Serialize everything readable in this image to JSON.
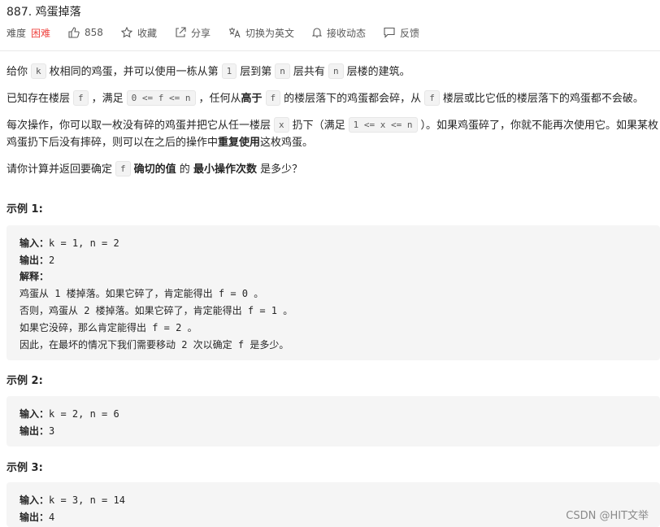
{
  "problem": {
    "title": "887. 鸡蛋掉落"
  },
  "meta": {
    "difficulty_label": "难度",
    "difficulty_value": "困难",
    "likes": "858",
    "favorite_label": "收藏",
    "share_label": "分享",
    "translate_label": "切换为英文",
    "subscribe_label": "接收动态",
    "feedback_label": "反馈",
    "icons": [
      "thumbs-up-icon",
      "star-icon",
      "share-icon",
      "translate-icon",
      "bell-icon",
      "feedback-icon"
    ],
    "difficulty_color": "#ef4743"
  },
  "description": {
    "p1": {
      "a": "给你",
      "k": "k",
      "b": "枚相同的鸡蛋，并可以使用一栋从第",
      "one": "1",
      "c": "层到第",
      "n": "n",
      "d": "层共有",
      "n2": "n",
      "e": "层楼的建筑。"
    },
    "p2": {
      "a": "已知存在楼层",
      "f": "f",
      "b": "，满足",
      "cond": "0 <= f <= n",
      "c": "，任何从",
      "higher": "高于",
      "f2": "f",
      "d": "的楼层落下的鸡蛋都会碎，从",
      "f3": "f",
      "e": "楼层或比它低的楼层落下的鸡蛋都不会破。"
    },
    "p3": {
      "a": "每次操作，你可以取一枚没有碎的鸡蛋并把它从任一楼层",
      "x": "x",
      "b": "扔下（满足",
      "cond": "1 <= x <= n",
      "c": "）。如果鸡蛋碎了，你就不能再次使用它。如果某枚",
      "d": "鸡蛋扔下后没有摔碎，则可以在之后的操作中",
      "reuse": "重复使用",
      "e": "这枚鸡蛋。"
    },
    "p4": {
      "a": "请你计算并返回要确定",
      "f": "f",
      "exact": "确切的值",
      "b": "的",
      "min_ops": "最小操作次数",
      "c": "是多少？"
    }
  },
  "examples": [
    {
      "title": "示例 1:",
      "input_label": "输入：",
      "input": "k = 1, n = 2",
      "output_label": "输出：",
      "output": "2",
      "explain_label": "解释：",
      "explain_lines": [
        "鸡蛋从 1 楼掉落。如果它碎了，肯定能得出 f = 0 。",
        "否则，鸡蛋从 2 楼掉落。如果它碎了，肯定能得出 f = 1 。",
        "如果它没碎，那么肯定能得出 f = 2 。",
        "因此，在最坏的情况下我们需要移动 2 次以确定 f 是多少。"
      ]
    },
    {
      "title": "示例 2:",
      "input_label": "输入：",
      "input": "k = 2, n = 6",
      "output_label": "输出：",
      "output": "3"
    },
    {
      "title": "示例 3:",
      "input_label": "输入：",
      "input": "k = 3, n = 14",
      "output_label": "输出：",
      "output": "4"
    }
  ],
  "watermark": "CSDN @HIT文举"
}
